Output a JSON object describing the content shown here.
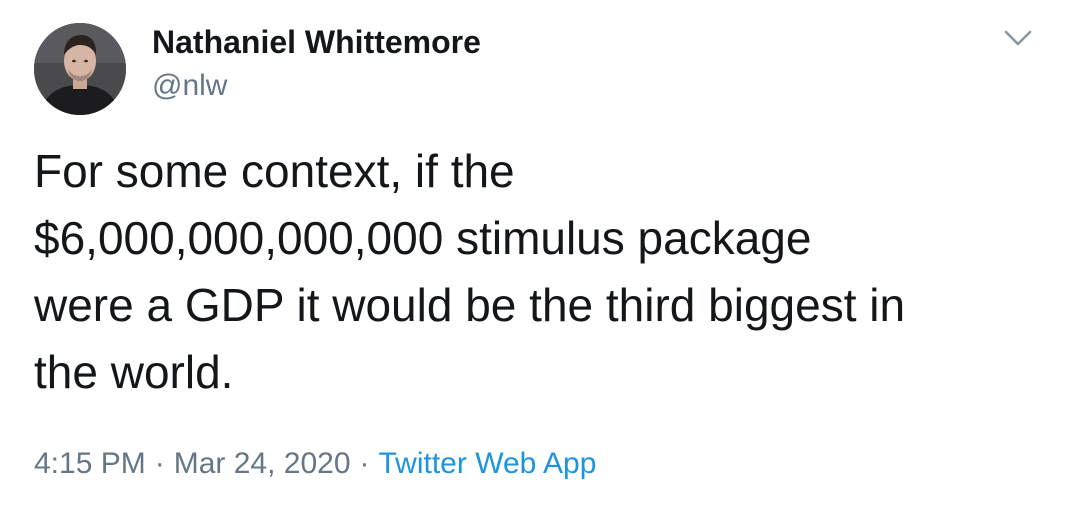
{
  "user": {
    "display_name": "Nathaniel Whittemore",
    "handle": "@nlw"
  },
  "tweet": {
    "lines": [
      "For some context, if the",
      "$6,000,000,000,000 stimulus package",
      "were a GDP it would be the third biggest in",
      "the world."
    ]
  },
  "meta": {
    "time": "4:15 PM",
    "separator": "·",
    "date": "Mar 24, 2020",
    "source": "Twitter Web App"
  },
  "icons": {
    "menu": "chevron-down-icon"
  },
  "colors": {
    "text": "#14171a",
    "secondary": "#657786",
    "link": "#1b95e0"
  }
}
